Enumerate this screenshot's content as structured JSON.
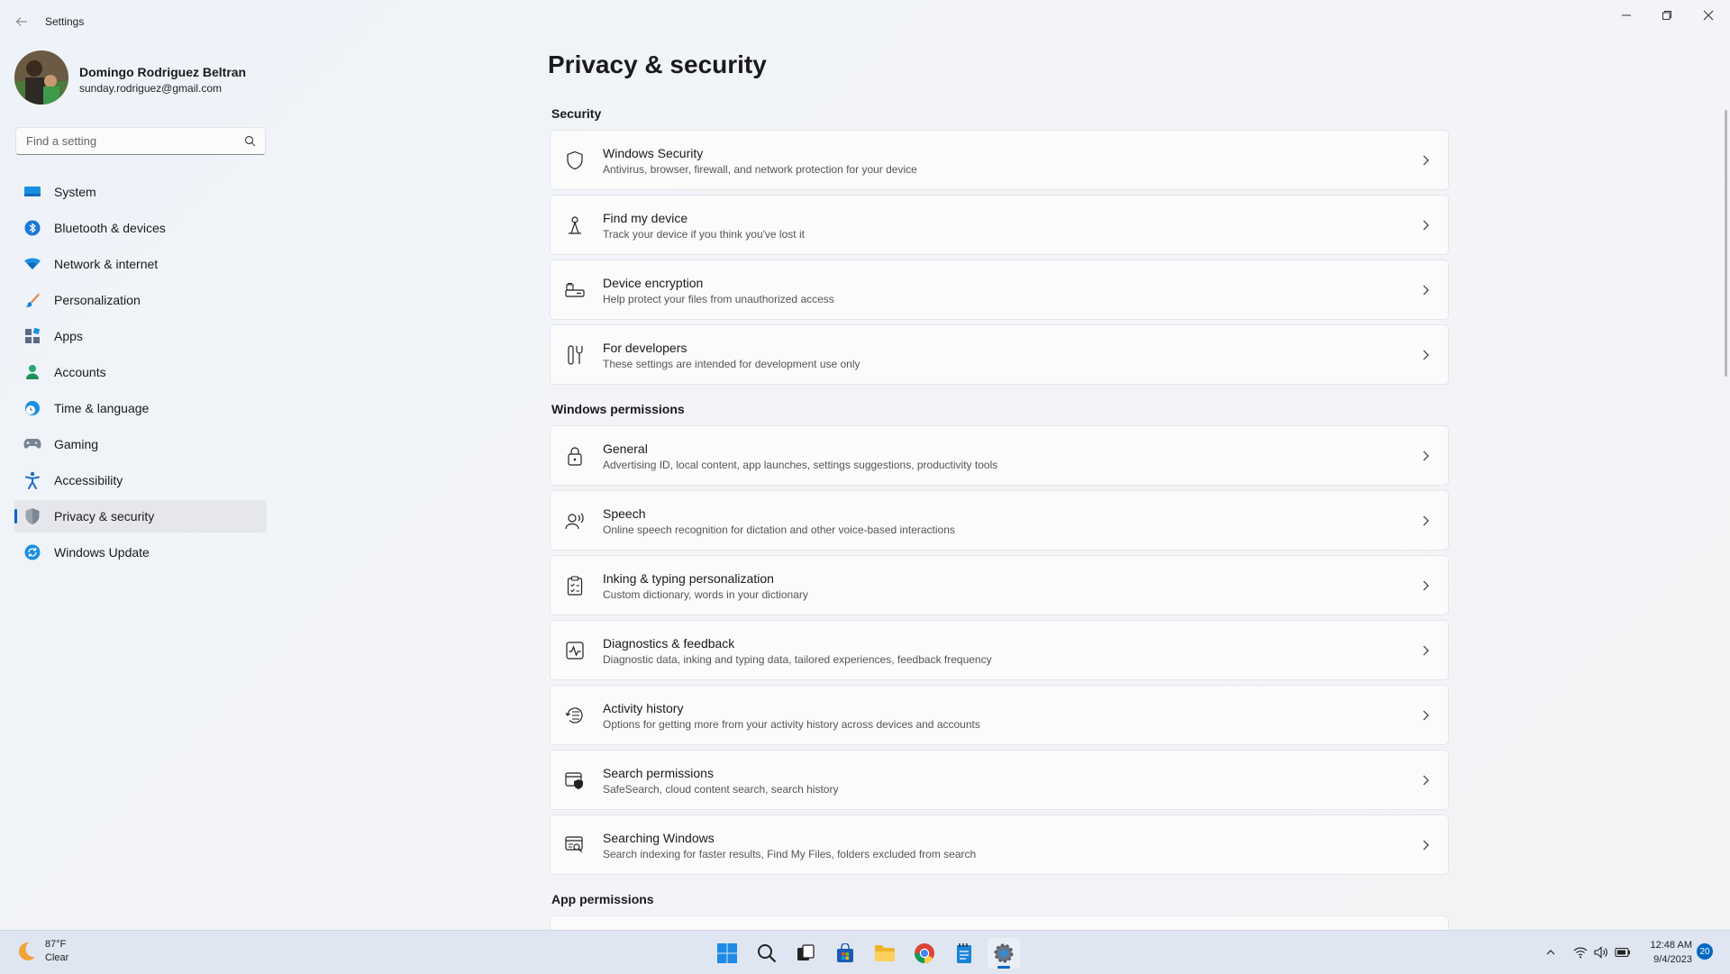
{
  "app": {
    "title": "Settings"
  },
  "profile": {
    "name": "Domingo Rodriguez Beltran",
    "email": "sunday.rodriguez@gmail.com"
  },
  "search": {
    "placeholder": "Find a setting"
  },
  "sidebar": {
    "items": [
      {
        "label": "System",
        "icon": "system-icon"
      },
      {
        "label": "Bluetooth & devices",
        "icon": "bluetooth-icon"
      },
      {
        "label": "Network & internet",
        "icon": "wifi-icon"
      },
      {
        "label": "Personalization",
        "icon": "brush-icon"
      },
      {
        "label": "Apps",
        "icon": "apps-icon"
      },
      {
        "label": "Accounts",
        "icon": "person-icon"
      },
      {
        "label": "Time & language",
        "icon": "globe-clock-icon"
      },
      {
        "label": "Gaming",
        "icon": "gamepad-icon"
      },
      {
        "label": "Accessibility",
        "icon": "accessibility-icon"
      },
      {
        "label": "Privacy & security",
        "icon": "shield-icon",
        "selected": true
      },
      {
        "label": "Windows Update",
        "icon": "update-icon"
      }
    ]
  },
  "main": {
    "title": "Privacy & security",
    "sections": {
      "security": {
        "title": "Security",
        "items": [
          {
            "title": "Windows Security",
            "desc": "Antivirus, browser, firewall, and network protection for your device"
          },
          {
            "title": "Find my device",
            "desc": "Track your device if you think you've lost it"
          },
          {
            "title": "Device encryption",
            "desc": "Help protect your files from unauthorized access"
          },
          {
            "title": "For developers",
            "desc": "These settings are intended for development use only"
          }
        ]
      },
      "windows_permissions": {
        "title": "Windows permissions",
        "items": [
          {
            "title": "General",
            "desc": "Advertising ID, local content, app launches, settings suggestions, productivity tools"
          },
          {
            "title": "Speech",
            "desc": "Online speech recognition for dictation and other voice-based interactions"
          },
          {
            "title": "Inking & typing personalization",
            "desc": "Custom dictionary, words in your dictionary"
          },
          {
            "title": "Diagnostics & feedback",
            "desc": "Diagnostic data, inking and typing data, tailored experiences, feedback frequency"
          },
          {
            "title": "Activity history",
            "desc": "Options for getting more from your activity history across devices and accounts"
          },
          {
            "title": "Search permissions",
            "desc": "SafeSearch, cloud content search, search history"
          },
          {
            "title": "Searching Windows",
            "desc": "Search indexing for faster results, Find My Files, folders excluded from search"
          }
        ]
      },
      "app_permissions": {
        "title": "App permissions"
      }
    }
  },
  "taskbar": {
    "weather": {
      "temp": "87°F",
      "condition": "Clear"
    },
    "clock": {
      "time": "12:48 AM",
      "date": "9/4/2023"
    },
    "notification_count": "20"
  },
  "colors": {
    "accent": "#0067c0",
    "selected_bg": "#e5e7ec"
  }
}
